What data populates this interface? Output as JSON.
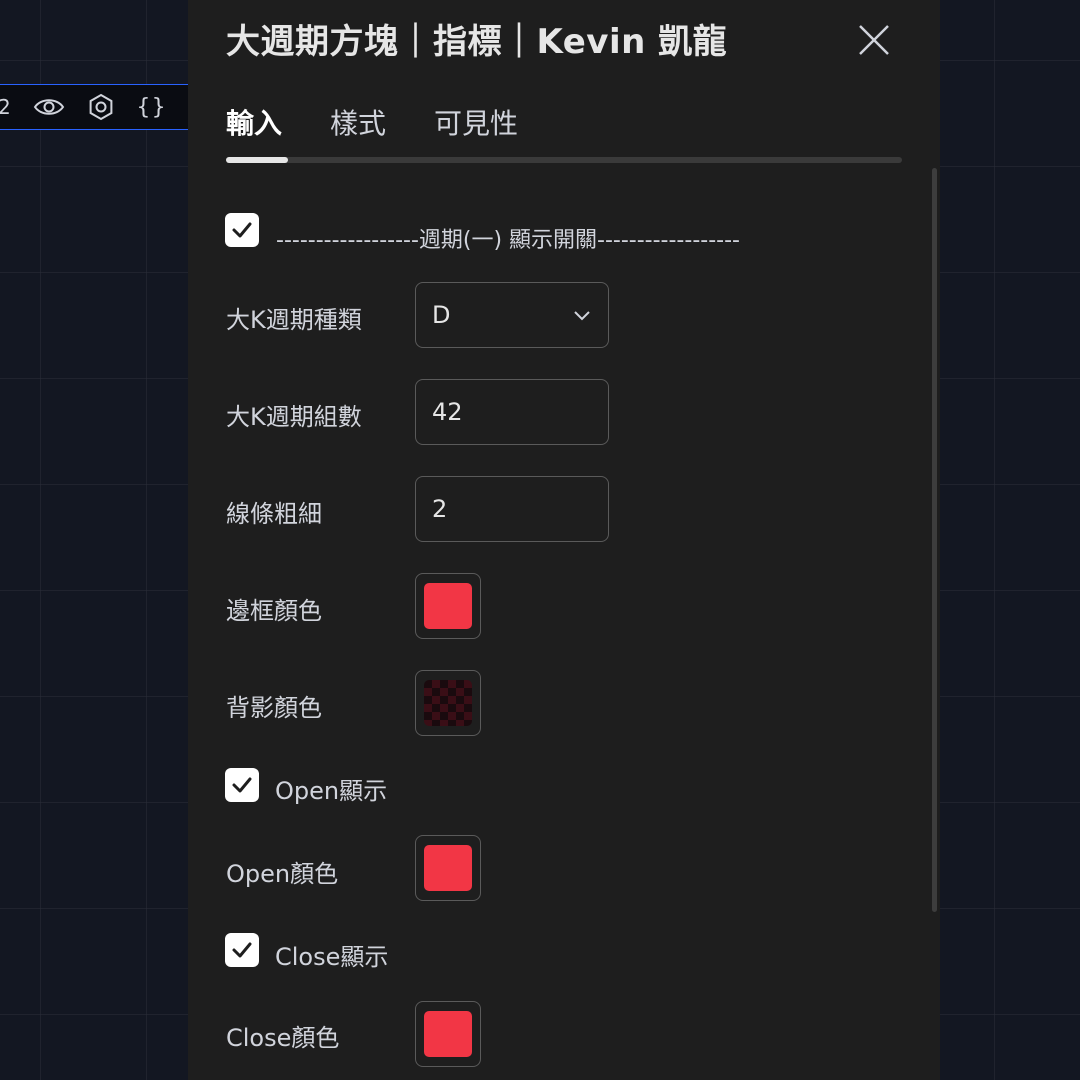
{
  "legend": {
    "text": "2",
    "braces": "{}"
  },
  "dialog": {
    "title": "大週期方塊｜指標｜Kevin 凱龍",
    "tabs": [
      {
        "label": "輸入"
      },
      {
        "label": "樣式"
      },
      {
        "label": "可見性"
      }
    ],
    "active_tab_index": 0
  },
  "inputs": {
    "section1": {
      "checked": true,
      "label": "------------------週期(一) 顯示開關------------------"
    },
    "period_type": {
      "label": "大K週期種類",
      "value": "D"
    },
    "period_count": {
      "label": "大K週期組數",
      "value": "42"
    },
    "line_width": {
      "label": "線條粗細",
      "value": "2"
    },
    "border_color": {
      "label": "邊框顏色",
      "color": "#f23645"
    },
    "bg_color": {
      "label": "背影顏色",
      "color": "#f23645",
      "opacity_pct": 10
    },
    "open_show": {
      "checked": true,
      "label": "Open顯示"
    },
    "open_color": {
      "label": "Open顏色",
      "color": "#f23645"
    },
    "close_show": {
      "checked": true,
      "label": "Close顯示"
    },
    "close_color": {
      "label": "Close顏色",
      "color": "#f23645"
    }
  },
  "colors": {
    "page_bg": "#131722",
    "dialog_bg": "#1e1e1e",
    "accent_blue": "#2962ff",
    "swatch_red": "#f23645"
  },
  "icons": {
    "close": "close-icon",
    "check": "check-icon",
    "chevron": "chevron-down-icon",
    "eye": "eye-icon",
    "settings": "settings-icon"
  }
}
